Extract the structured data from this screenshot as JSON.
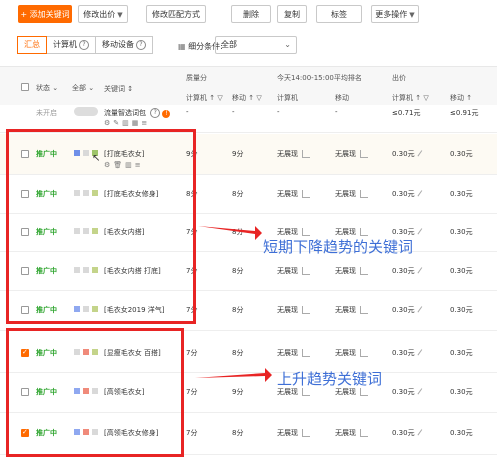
{
  "toolbar": {
    "add_keyword": "+ 添加关键词",
    "modify_bid": "修改出价",
    "modify_match": "修改匹配方式",
    "delete": "删除",
    "copy": "复制",
    "tag": "标签",
    "more": "更多操作"
  },
  "tabs": {
    "summary": "汇总",
    "computer": "计算机",
    "mobile": "移动设备"
  },
  "filter": {
    "label": "细分条件:",
    "value": "全部"
  },
  "table_header": {
    "status": "状态",
    "all": "全部",
    "keyword": "关键词",
    "quality": "质量分",
    "computer": "计算机",
    "mobile": "移动",
    "rank_title": "今天14:00-15:00平均排名",
    "rank_computer": "计算机",
    "rank_mobile": "移动",
    "bid_title": "出价",
    "bid_computer": "计算机",
    "bid_mobile": "移动"
  },
  "first_row": {
    "status": "未开启",
    "keyword": "流量智选词包",
    "quality_computer": "-",
    "quality_mobile": "-",
    "rank_computer": "-",
    "rank_mobile": "-",
    "bid_computer": "≤0.71元",
    "bid_mobile": "≤0.91元"
  },
  "rows": [
    {
      "status": "推广中",
      "keyword": "[打底毛衣女]",
      "quality_computer": "9分",
      "quality_mobile": "9分",
      "rank_computer": "无展现",
      "rank_mobile": "无展现",
      "bid_computer": "0.30元",
      "bid_mobile": "0.30元"
    },
    {
      "status": "推广中",
      "keyword": "[打底毛衣女修身]",
      "quality_computer": "8分",
      "quality_mobile": "8分",
      "rank_computer": "无展现",
      "rank_mobile": "无展现",
      "bid_computer": "0.30元",
      "bid_mobile": "0.30元"
    },
    {
      "status": "推广中",
      "keyword": "[毛衣女内搭]",
      "quality_computer": "7分",
      "quality_mobile": "8分",
      "rank_computer": "无展现",
      "rank_mobile": "无展现",
      "bid_computer": "0.30元",
      "bid_mobile": "0.30元"
    },
    {
      "status": "推广中",
      "keyword": "[毛衣女内搭 打底]",
      "quality_computer": "7分",
      "quality_mobile": "8分",
      "rank_computer": "无展现",
      "rank_mobile": "无展现",
      "bid_computer": "0.30元",
      "bid_mobile": "0.30元"
    },
    {
      "status": "推广中",
      "keyword": "[毛衣女2019 洋气]",
      "quality_computer": "7分",
      "quality_mobile": "8分",
      "rank_computer": "无展现",
      "rank_mobile": "无展现",
      "bid_computer": "0.30元",
      "bid_mobile": "0.30元"
    },
    {
      "status": "推广中",
      "keyword": "[显瘦毛衣女 百搭]",
      "quality_computer": "7分",
      "quality_mobile": "8分",
      "rank_computer": "无展现",
      "rank_mobile": "无展现",
      "bid_computer": "0.30元",
      "bid_mobile": "0.30元"
    },
    {
      "status": "推广中",
      "keyword": "[高领毛衣女]",
      "quality_computer": "7分",
      "quality_mobile": "9分",
      "rank_computer": "无展现",
      "rank_mobile": "无展现",
      "bid_computer": "0.30元",
      "bid_mobile": "0.30元"
    },
    {
      "status": "推广中",
      "keyword": "[高领毛衣女修身]",
      "quality_computer": "7分",
      "quality_mobile": "8分",
      "rank_computer": "无展现",
      "rank_mobile": "无展现",
      "bid_computer": "0.30元",
      "bid_mobile": "0.30元"
    }
  ],
  "annotations": {
    "down_trend": "短期下降趋势的关键词",
    "up_trend": "上升趋势关键词"
  },
  "colors": {
    "accent": "#ff6a00",
    "status_active": "#2aa32a",
    "highlight_box": "#e82424",
    "annotation_text": "#3e6fd6"
  }
}
